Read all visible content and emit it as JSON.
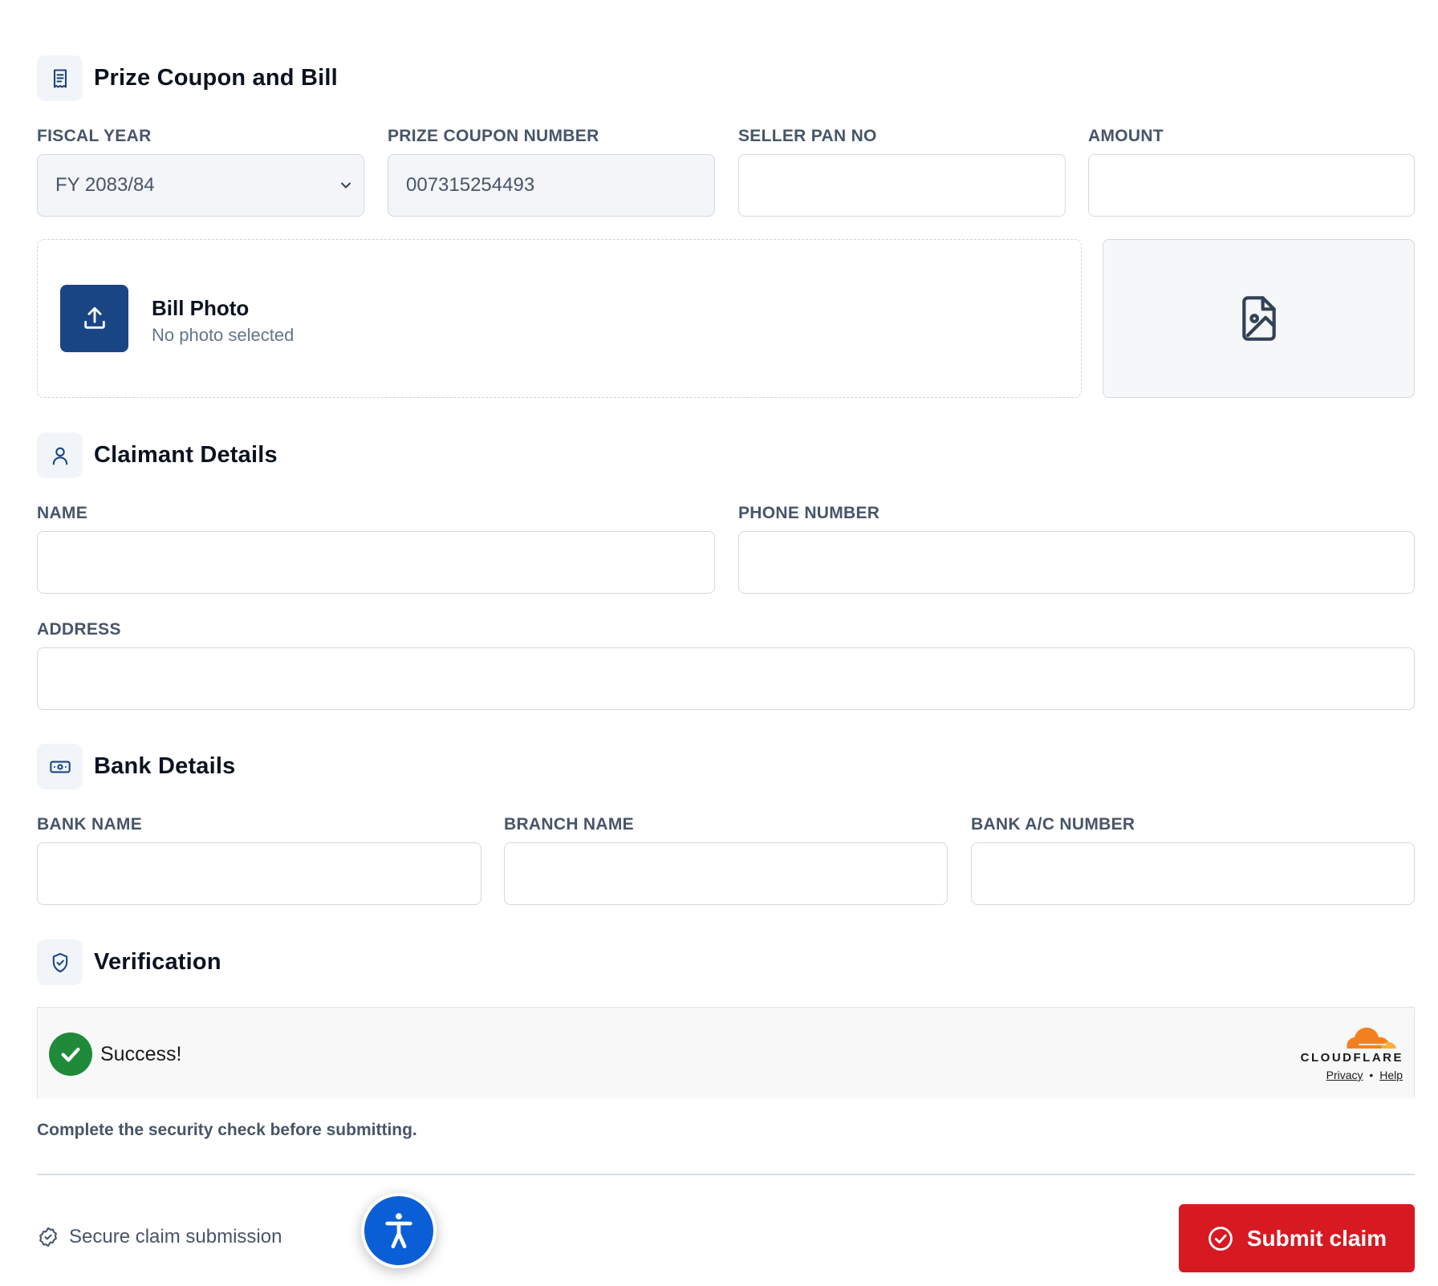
{
  "sections": {
    "prize": {
      "title": "Prize Coupon and Bill",
      "icon": "receipt-icon"
    },
    "claimant": {
      "title": "Claimant Details",
      "icon": "user-icon"
    },
    "bank": {
      "title": "Bank Details",
      "icon": "banknote-icon"
    },
    "verification": {
      "title": "Verification",
      "icon": "shield-check-icon"
    }
  },
  "prize_fields": {
    "fiscal_year": {
      "label": "FISCAL YEAR",
      "value": "FY 2083/84"
    },
    "coupon_number": {
      "label": "PRIZE COUPON NUMBER",
      "value": "007315254493"
    },
    "seller_pan": {
      "label": "SELLER PAN NO",
      "value": ""
    },
    "amount": {
      "label": "AMOUNT",
      "value": ""
    }
  },
  "bill_photo": {
    "title": "Bill Photo",
    "status": "No photo selected"
  },
  "claimant_fields": {
    "name": {
      "label": "NAME",
      "value": ""
    },
    "phone": {
      "label": "PHONE NUMBER",
      "value": ""
    },
    "address": {
      "label": "ADDRESS",
      "value": ""
    }
  },
  "bank_fields": {
    "bank_name": {
      "label": "BANK NAME",
      "value": ""
    },
    "branch_name": {
      "label": "BRANCH NAME",
      "value": ""
    },
    "account_number": {
      "label": "BANK A/C NUMBER",
      "value": ""
    }
  },
  "captcha": {
    "status": "Success!",
    "brand": "CLOUDFLARE",
    "privacy": "Privacy",
    "separator": "•",
    "help": "Help"
  },
  "hint": "Complete the security check before submitting.",
  "footer": {
    "secure_text": "Secure claim submission",
    "submit_label": "Submit claim"
  },
  "colors": {
    "primary": "#1a4585",
    "submit": "#d71921",
    "success": "#1f8a3a",
    "cloudflare_orange": "#f38020",
    "accessibility": "#0a5fd6"
  }
}
